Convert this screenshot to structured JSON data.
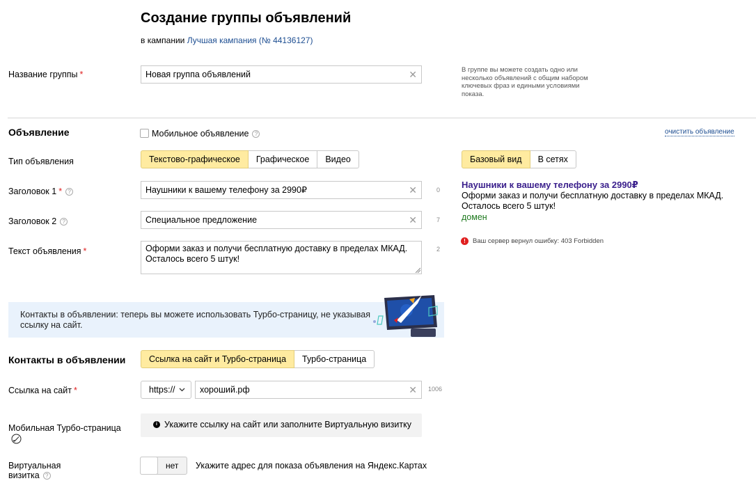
{
  "header": {
    "title": "Создание группы объявлений",
    "campaign_prefix": "в кампании",
    "campaign_link": "Лучшая кампания (№ 44136127)"
  },
  "group": {
    "label": "Название группы",
    "required_mark": "*",
    "value": "Новая группа объявлений",
    "hint": "В группе вы можете создать одно или несколько объявлений с общим набором ключевых фраз и едиными условиями показа."
  },
  "ad": {
    "section_title": "Объявление",
    "mobile_checkbox_label": "Мобильное объявление",
    "clear_link": "очистить объявление",
    "type_label": "Тип объявления",
    "type_options": [
      "Текстово-графическое",
      "Графическое",
      "Видео"
    ],
    "type_selected": "Текстово-графическое",
    "title1_label": "Заголовок 1",
    "title1_value": "Наушники к вашему телефону за 2990₽",
    "title1_counter": "0",
    "title2_label": "Заголовок 2",
    "title2_value": "Специальное предложение",
    "title2_counter": "7",
    "text_label": "Текст объявления",
    "text_value": "Оформи заказ и получи бесплатную доставку в пределах МКАД. Осталось всего 5 штук!",
    "text_counter": "2"
  },
  "preview": {
    "view_options": [
      "Базовый вид",
      "В сетях"
    ],
    "view_selected": "Базовый вид",
    "title": "Наушники к вашему телефону за 2990₽",
    "text": "Оформи заказ и получи бесплатную доставку в пределах МКАД. Осталось всего 5 штук!",
    "domain": "домен",
    "error": "Ваш сервер вернул ошибку: 403 Forbidden"
  },
  "banner": {
    "text": "Контакты в объявлении: теперь вы можете использовать Турбо-страницу, не указывая ссылку на сайт."
  },
  "contacts": {
    "section_title": "Контакты в объявлении",
    "options": [
      "Ссылка на сайт и Турбо-страница",
      "Турбо-страница"
    ],
    "selected": "Ссылка на сайт и Турбо-страница",
    "link_label": "Ссылка на сайт",
    "protocol": "https://",
    "link_value": "хороший.рф",
    "link_counter": "1006",
    "turbo_label": "Мобильная Турбо-страница",
    "turbo_notice": "Укажите ссылку на сайт или заполните Виртуальную визитку",
    "vcard_label_line1": "Виртуальная",
    "vcard_label_line2": "визитка",
    "vcard_toggle": "нет",
    "vcard_hint": "Укажите адрес для показа объявления на Яндекс.Картах"
  },
  "colors": {
    "accent_yellow": "#ffeba0",
    "link_blue": "#1c4d91",
    "preview_title": "#3a1f8c",
    "domain_green": "#1f7a1f",
    "error_red": "#e02020",
    "banner_bg": "#e9f2fc"
  },
  "icons": {
    "clear": "close-icon",
    "help": "question-icon",
    "error": "exclamation-icon",
    "info": "info-icon",
    "turbo": "rocket-icon",
    "dropdown": "chevron-down-icon"
  }
}
